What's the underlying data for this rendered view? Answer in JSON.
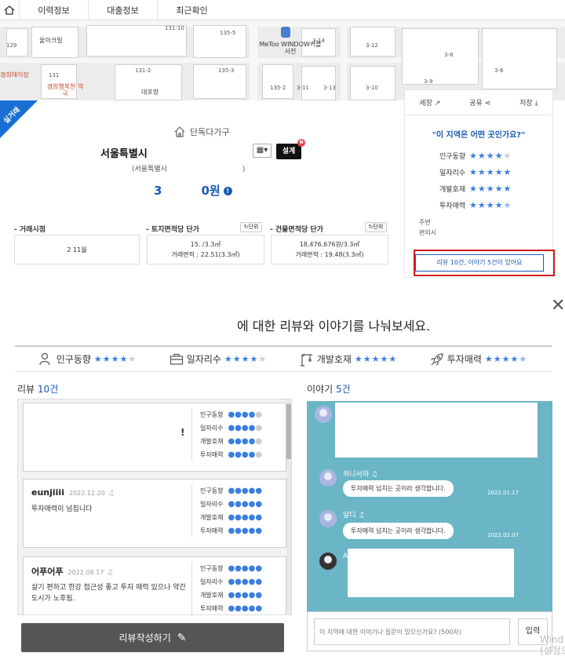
{
  "tabs": [
    "이력정보",
    "대출정보",
    "최근확인"
  ],
  "map": {
    "labels": [
      "131-10",
      "135-5",
      "3-14",
      "3-12",
      "3-8",
      "129",
      "131-2",
      "135-3",
      "3-13",
      "3-10",
      "3-6",
      "131",
      "135-2",
      "3-9",
      "3-11"
    ],
    "pois": [
      "울아크릴",
      "경희태이장",
      "경희행복한 약국",
      "대포항"
    ],
    "landmark": "MeToo WINDOW커플사진"
  },
  "badge": "실거래",
  "property": {
    "type": "단독다가구",
    "address": "서울특별시",
    "address_sub": "(서울특별시",
    "address_sub_tail": ")",
    "price_left": "3",
    "price_right": "0원",
    "design_label": "설계",
    "design_badge": "N"
  },
  "stats": [
    {
      "label": "- 거래시점",
      "unit": "",
      "line1": "2          11월",
      "line2": ""
    },
    {
      "label": "- 토지면적당 단가",
      "unit": "단위",
      "line1": "15.        /3.3㎡",
      "line2": "거래면적 : 22.51(3.3㎡)"
    },
    {
      "label": "- 건물면적당 단가",
      "unit": "단위",
      "line1": "18,476,676원/3.3㎡",
      "line2": "거래면적 : 19.48(3.3㎡)"
    }
  ],
  "right_panel": {
    "actions": [
      "세장",
      "공유",
      "저장"
    ],
    "question": "\"이 지역은 어떤 곳인가요?\"",
    "ratings": [
      {
        "label": "인구동향",
        "score": 4
      },
      {
        "label": "일자리수",
        "score": 5
      },
      {
        "label": "개발호재",
        "score": 5
      },
      {
        "label": "투자매력",
        "score": 4.5
      }
    ],
    "more_line1": "주변",
    "more_line2": "편의시",
    "button": "리뷰 10건, 이야기 5건이 있어요"
  },
  "modal": {
    "title": "에 대한 리뷰와 이야기를 나눠보세요.",
    "categories": [
      {
        "icon": "person-chart-icon",
        "label": "인구동향",
        "score": 4
      },
      {
        "icon": "briefcase-icon",
        "label": "일자리수",
        "score": 4
      },
      {
        "icon": "crane-icon",
        "label": "개발호재",
        "score": 5
      },
      {
        "icon": "rocket-icon",
        "label": "투자매력",
        "score": 4.5
      }
    ],
    "review_title": "리뷰",
    "review_count": "10건",
    "story_title": "이야기",
    "story_count": "5건",
    "rating_labels": [
      "인구동향",
      "일자리수",
      "개발호재",
      "투자매력"
    ],
    "reviews": [
      {
        "name": "",
        "date": "",
        "text": "",
        "mark": "!",
        "scores": [
          4,
          4,
          4,
          4
        ]
      },
      {
        "name": "eunjiiii",
        "date": "2022.12.20",
        "text": "투자매력이 넘칩니다",
        "scores": [
          5,
          5,
          5,
          5
        ]
      },
      {
        "name": "어푸어푸",
        "date": "2022.08.17",
        "text": "살기 편하고 한강 접근성 좋고 투자 매력 있으나 약간 도시가 노후됨.",
        "scores": [
          5,
          5,
          5,
          5
        ]
      }
    ],
    "stories": [
      {
        "name": "허니서하",
        "text": "투자매력 넘치는 곳이라 생각합니다.",
        "date": "2022.01.17"
      },
      {
        "name": "달디",
        "text": "투자매력 넘치는 곳이라 생각합니다.",
        "date": "2022.02.07"
      },
      {
        "name": "A",
        "text": "",
        "date": ""
      }
    ],
    "write_button": "리뷰작성하기",
    "chat_placeholder": "이 지역에 대한 이야기나 질문이 있으신가요? (500자)",
    "send_button": "입력"
  },
  "watermark": "Wind\n(설정으"
}
